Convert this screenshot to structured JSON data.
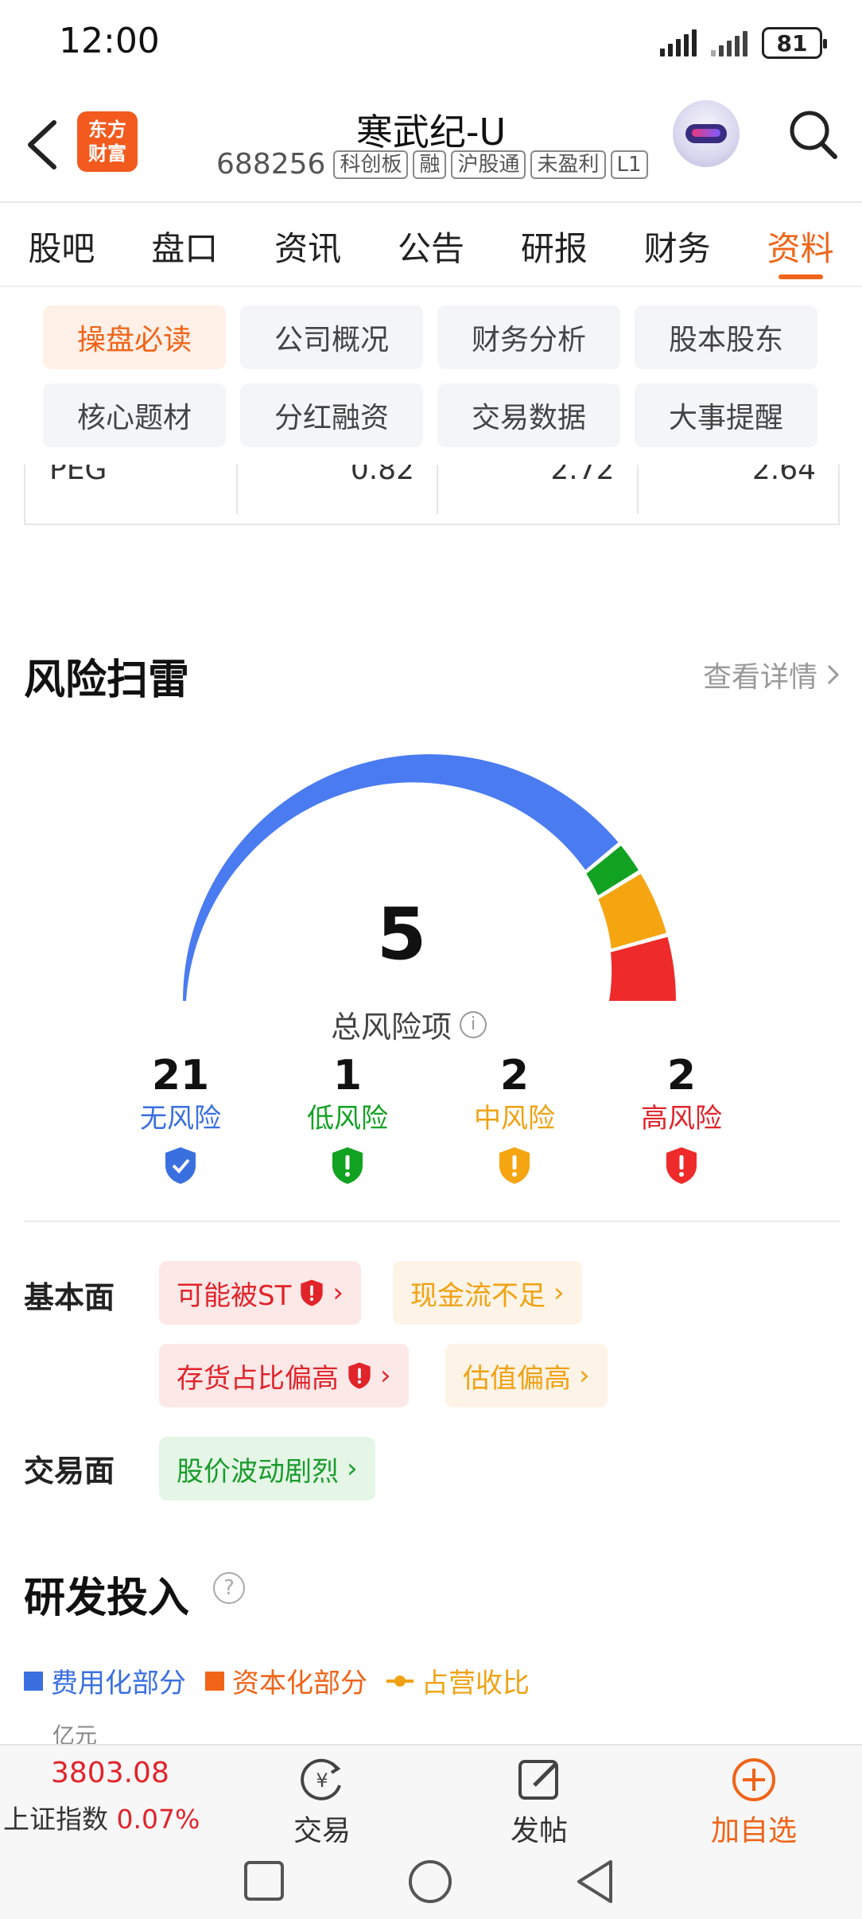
{
  "status_bar": {
    "time": "12:00",
    "battery": "81"
  },
  "header": {
    "logo_text_top": "东方",
    "logo_text_bottom": "财富",
    "stock_name": "寒武纪-U",
    "stock_code": "688256",
    "tags": [
      "科创板",
      "融",
      "沪股通",
      "未盈利",
      "L1"
    ]
  },
  "tabs": [
    {
      "label": "股吧"
    },
    {
      "label": "盘口"
    },
    {
      "label": "资讯"
    },
    {
      "label": "公告"
    },
    {
      "label": "研报"
    },
    {
      "label": "财务"
    },
    {
      "label": "资料",
      "active": true
    }
  ],
  "subtabs": [
    {
      "label": "操盘必读",
      "active": true
    },
    {
      "label": "公司概况"
    },
    {
      "label": "财务分析"
    },
    {
      "label": "股本股东"
    },
    {
      "label": "核心题材"
    },
    {
      "label": "分红融资"
    },
    {
      "label": "交易数据"
    },
    {
      "label": "大事提醒"
    }
  ],
  "peg_row": {
    "label": "PEG",
    "values": [
      "0.82",
      "2.72",
      "2.64"
    ]
  },
  "risk": {
    "title": "风险扫雷",
    "detail_link": "查看详情",
    "total": "5",
    "total_label": "总风险项",
    "colors": {
      "none": "#4a7bf0",
      "low": "#12a221",
      "mid": "#f5a50f",
      "high": "#ee2a2a"
    },
    "stats": [
      {
        "count": "21",
        "label": "无风险",
        "color": "#3a6fe0"
      },
      {
        "count": "1",
        "label": "低风险",
        "color": "#12a221"
      },
      {
        "count": "2",
        "label": "中风险",
        "color": "#f0a212"
      },
      {
        "count": "2",
        "label": "高风险",
        "color": "#e0242a"
      }
    ],
    "fundamental_label": "基本面",
    "fundamental_items": [
      "可能被ST",
      "现金流不足",
      "存货占比偏高",
      "估值偏高"
    ],
    "trading_label": "交易面",
    "trading_items": [
      "股价波动剧烈"
    ]
  },
  "rd": {
    "title": "研发投入",
    "legend": [
      {
        "label": "费用化部分",
        "color": "#3a6fe0"
      },
      {
        "label": "资本化部分",
        "color": "#f06418"
      },
      {
        "label": "占营收比",
        "color": "#f0a212"
      }
    ],
    "unit": "亿元"
  },
  "bottom_bar": {
    "index_value": "3803.08",
    "index_name": "上证指数",
    "index_change": "0.07%",
    "trade_label": "交易",
    "post_label": "发帖",
    "add_label": "加自选"
  }
}
